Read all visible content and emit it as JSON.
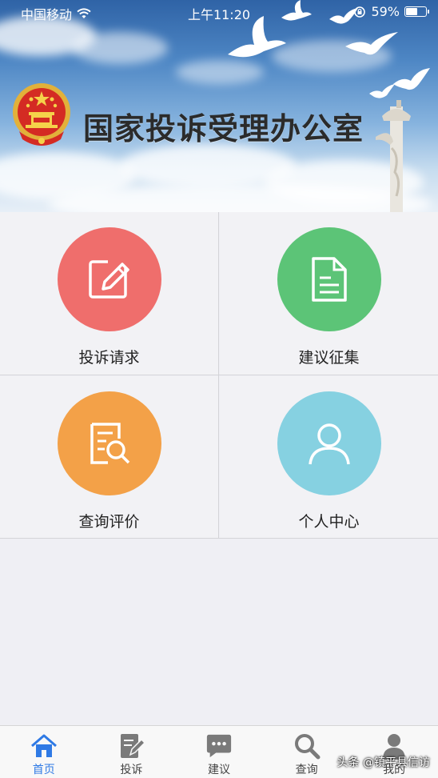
{
  "status": {
    "carrier": "中国移动",
    "time": "上午11:20",
    "battery": "59%",
    "battery_level": 0.59
  },
  "banner": {
    "title": "国家投诉受理办公室"
  },
  "tiles": [
    {
      "label": "投诉请求",
      "color": "#ef6e6c",
      "icon": "edit-icon"
    },
    {
      "label": "建议征集",
      "color": "#5cc477",
      "icon": "document-icon"
    },
    {
      "label": "查询评价",
      "color": "#f3a148",
      "icon": "search-document-icon"
    },
    {
      "label": "个人中心",
      "color": "#86d1e1",
      "icon": "user-icon"
    }
  ],
  "tabbar": {
    "active_color": "#2f7ae5",
    "items": [
      {
        "label": "首页",
        "icon": "home-icon"
      },
      {
        "label": "投诉",
        "icon": "complaint-icon"
      },
      {
        "label": "建议",
        "icon": "chat-icon"
      },
      {
        "label": "查询",
        "icon": "search-icon"
      },
      {
        "label": "我的",
        "icon": "user-icon"
      }
    ]
  },
  "watermark": "头条 @镇平县信访"
}
